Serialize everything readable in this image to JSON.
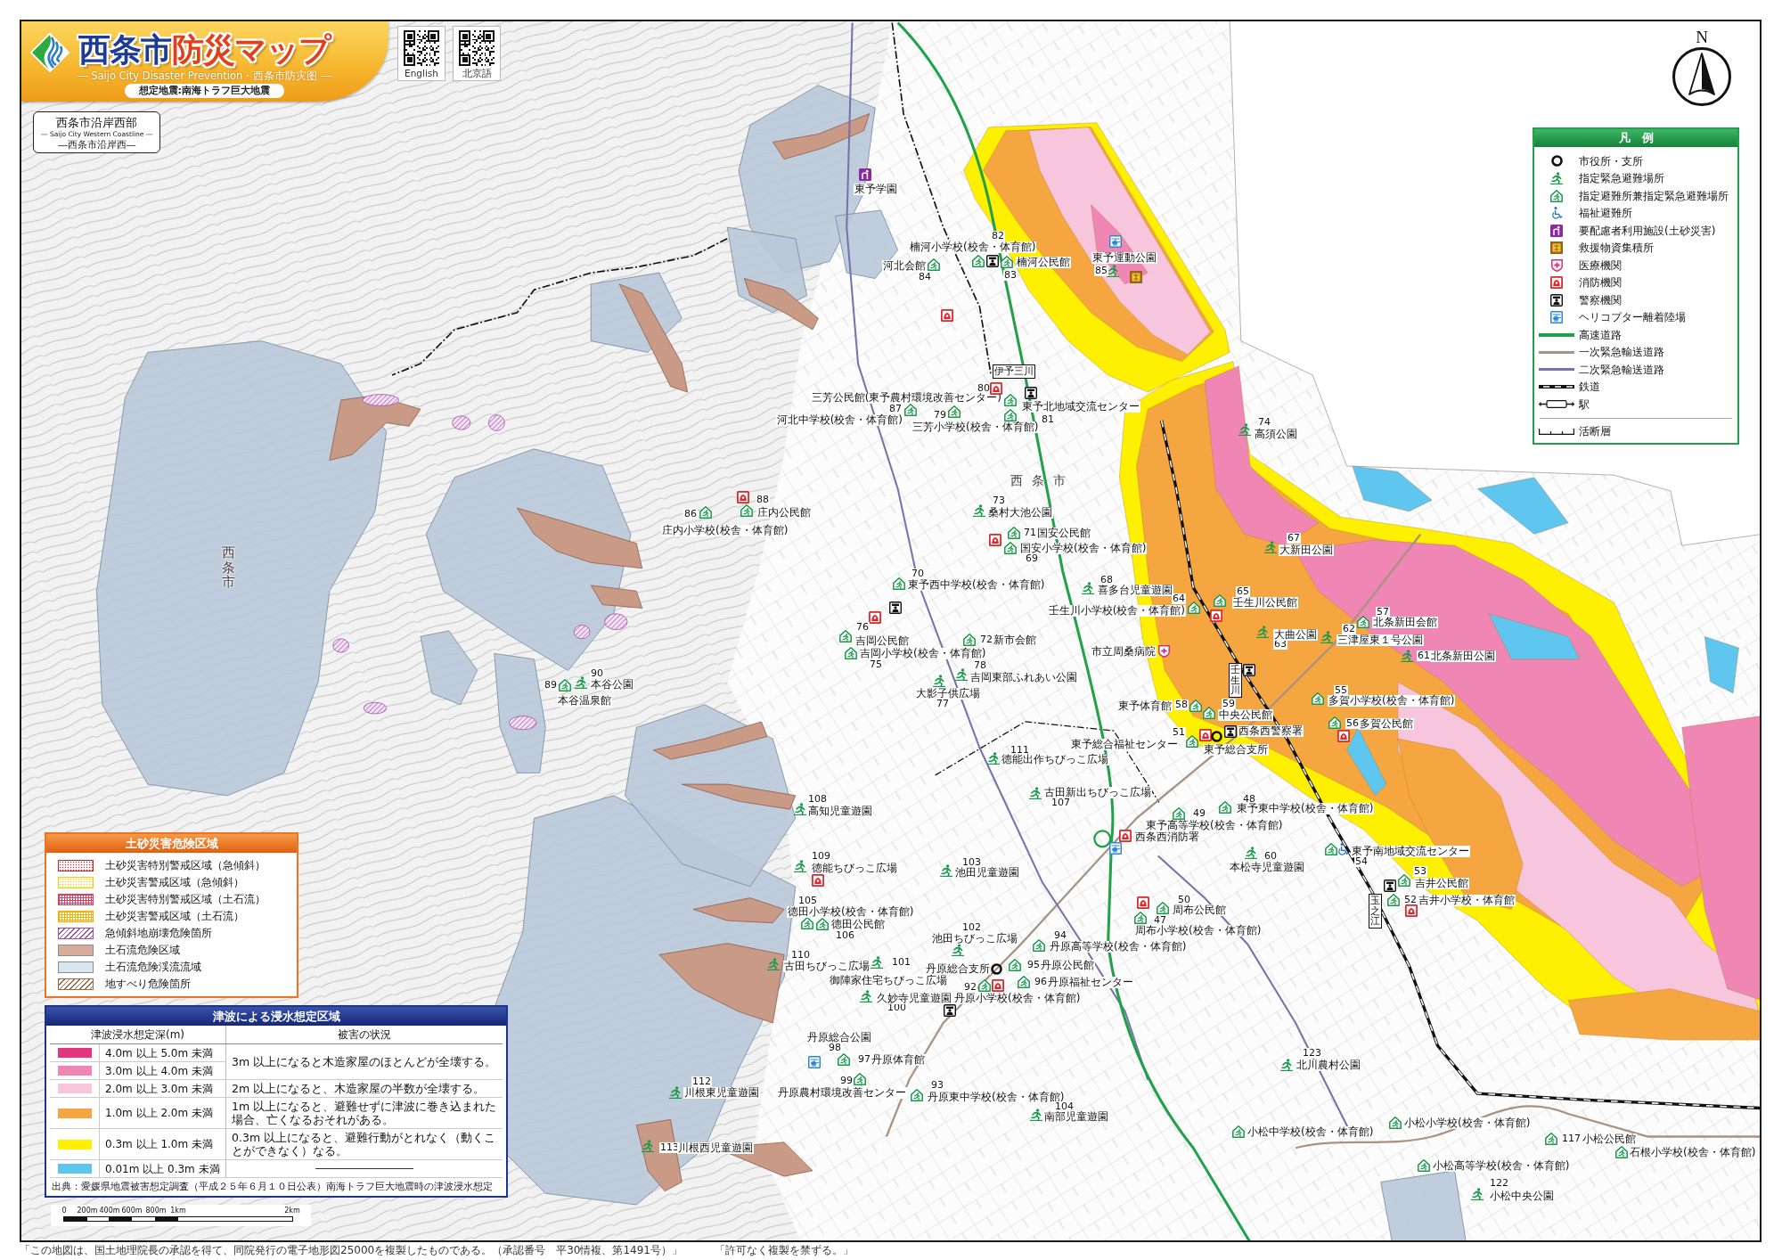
{
  "title": {
    "city": "西条市",
    "name": "防災マップ",
    "subtitle": "― Saijo City Disaster Prevention・西条市防灾图 ―",
    "scenario": "想定地震:南海トラフ巨大地震"
  },
  "qr_codes": [
    {
      "label": "English"
    },
    {
      "label": "北京語"
    }
  ],
  "area": {
    "name": "西条市沿岸西部",
    "english": "― Saijo City Western Coastline ―",
    "chinese": "―西条市沿岸西―"
  },
  "north_arrow": {
    "label": "N"
  },
  "legend": {
    "title": "凡　例",
    "items": [
      {
        "kind": "city-hall",
        "label": "市役所・支所"
      },
      {
        "kind": "evacuation-site",
        "label": "指定緊急避難場所"
      },
      {
        "kind": "shelter",
        "label": "指定避難所兼指定緊急避難場所"
      },
      {
        "kind": "welfare",
        "label": "福祉避難所"
      },
      {
        "kind": "care-facility",
        "label": "要配慮者利用施設(土砂災害)"
      },
      {
        "kind": "supply-depot",
        "label": "救援物資集積所"
      },
      {
        "kind": "medical",
        "label": "医療機関"
      },
      {
        "kind": "fire",
        "label": "消防機関"
      },
      {
        "kind": "police",
        "label": "警察機関"
      },
      {
        "kind": "heliport",
        "label": "ヘリコプター離着陸場"
      },
      {
        "kind": "expressway",
        "label": "高速道路"
      },
      {
        "kind": "primary-road",
        "label": "一次緊急輸送道路"
      },
      {
        "kind": "secondary-road",
        "label": "二次緊急輸送道路"
      },
      {
        "kind": "railway",
        "label": "鉄道"
      },
      {
        "kind": "station",
        "label": "駅"
      }
    ],
    "items_after_rule": [
      {
        "kind": "fault",
        "label": "活断層"
      }
    ]
  },
  "landslide_legend": {
    "title": "土砂災害危険区域",
    "items": [
      {
        "kind": "dots",
        "color": "#d9252a",
        "label": "土砂災害特別警戒区域（急傾斜）"
      },
      {
        "kind": "dots",
        "color": "#f2d200",
        "label": "土砂災害警戒区域（急傾斜）"
      },
      {
        "kind": "grid",
        "color": "#e0405e",
        "label": "土砂災害特別警戒区域（土石流）"
      },
      {
        "kind": "grid",
        "color": "#f0b400",
        "label": "土砂災害警戒区域（土石流）"
      },
      {
        "kind": "hatch",
        "color": "#a24ca8",
        "label": "急傾斜地崩壊危険箇所"
      },
      {
        "kind": "solid",
        "color": "#d8ac9c",
        "label": "土石流危険区域"
      },
      {
        "kind": "solid",
        "color": "#d8e6f0",
        "label": "土石流危険渓流流域"
      },
      {
        "kind": "hatch",
        "color": "#9c6a40",
        "label": "地すべり危険箇所"
      }
    ]
  },
  "tsunami_legend": {
    "title": "津波による浸水想定区域",
    "depth_header": "津波浸水想定深(m)",
    "damage_header": "被害の状況",
    "bands": [
      {
        "note": "3m 以上になると木造家屋のほとんどが全壊する。",
        "depths": [
          {
            "color": "#e5347f",
            "label": "4.0m 以上 5.0m 未満"
          },
          {
            "color": "#ef86b4",
            "label": "3.0m 以上 4.0m 未満"
          }
        ]
      },
      {
        "note": "2m 以上になると、木造家屋の半数が全壊する。",
        "depths": [
          {
            "color": "#f7c6dc",
            "label": "2.0m 以上 3.0m 未満"
          }
        ]
      },
      {
        "note": "1m 以上になると、避難せずに津波に巻き込まれた場合、亡くなるおそれがある。",
        "depths": [
          {
            "color": "#f5a640",
            "label": "1.0m 以上 2.0m 未満"
          }
        ]
      },
      {
        "note": "0.3m 以上になると、避難行動がとれなく（動くことができなく）なる。",
        "depths": [
          {
            "color": "#fff000",
            "label": "0.3m 以上 1.0m 未満"
          }
        ]
      },
      {
        "depths": [
          {
            "color": "#5ec6ef",
            "label": "0.01m 以上 0.3m 未満"
          }
        ]
      }
    ],
    "source": "出典：愛媛県地震被害想定調査（平成２５年６月１０日公表）南海トラフ巨大地震時の津波浸水想定"
  },
  "scale_bar": {
    "labels": [
      "0",
      "200m",
      "400m",
      "600m",
      "800m",
      "1km",
      "2km"
    ]
  },
  "map": {
    "place_names": [
      {
        "kind": "vertical",
        "text": "西条市"
      },
      {
        "kind": "horizontal",
        "text": "西条市"
      }
    ],
    "stations": [
      {
        "name": "伊予三川"
      },
      {
        "name": "壬生川"
      },
      {
        "name": "玉之江"
      }
    ],
    "facilities": [
      {
        "kind": "care-facility",
        "name": "東予学園"
      },
      {
        "kind": "shelter",
        "number": "82",
        "name": "楠河小学校(校舎・体育館)"
      },
      {
        "kind": "heliport"
      },
      {
        "kind": "shelter",
        "number": "84",
        "name": "河北会館"
      },
      {
        "kind": "police"
      },
      {
        "kind": "shelter",
        "number": "83",
        "name": "楠河公民館"
      },
      {
        "kind": "evacuation-site",
        "number": "85",
        "name": "東予運動公園"
      },
      {
        "kind": "supply-depot"
      },
      {
        "kind": "fire"
      },
      {
        "kind": "shelter",
        "number": "80",
        "name": "三芳公民館(東予農村環境改善センター)"
      },
      {
        "kind": "fire"
      },
      {
        "kind": "police"
      },
      {
        "kind": "shelter",
        "number": "87",
        "name": "河北中学校(校舎・体育館)"
      },
      {
        "kind": "shelter",
        "number": "79",
        "name": "三芳小学校(校舎・体育館)"
      },
      {
        "kind": "shelter",
        "number": "81",
        "name": "東予北地域交流センター"
      },
      {
        "kind": "evacuation-site",
        "number": "74",
        "name": "高須公園"
      },
      {
        "kind": "fire"
      },
      {
        "kind": "shelter",
        "number": "88",
        "name": "庄内公民館"
      },
      {
        "kind": "evacuation-site",
        "number": "73",
        "name": "桑村大池公園"
      },
      {
        "kind": "shelter",
        "number": "86",
        "name": "庄内小学校(校舎・体育館)"
      },
      {
        "kind": "fire"
      },
      {
        "kind": "shelter",
        "number": "71",
        "name": "国安公民館"
      },
      {
        "kind": "shelter",
        "number": "69",
        "name": "国安小学校(校舎・体育館)"
      },
      {
        "kind": "evacuation-site",
        "number": "67",
        "name": "大新田公園"
      },
      {
        "kind": "shelter",
        "number": "70",
        "name": "東予西中学校(校舎・体育館)"
      },
      {
        "kind": "evacuation-site",
        "number": "68",
        "name": "喜多台児童遊園"
      },
      {
        "kind": "fire"
      },
      {
        "kind": "police"
      },
      {
        "kind": "shelter",
        "number": "64",
        "name": "壬生川小学校(校舎・体育館)"
      },
      {
        "kind": "shelter",
        "number": "65",
        "name": "壬生川公民館"
      },
      {
        "kind": "fire"
      },
      {
        "kind": "shelter",
        "number": "57",
        "name": "北条新田会館"
      },
      {
        "kind": "shelter",
        "number": "76",
        "name": "吉岡公民館"
      },
      {
        "kind": "shelter",
        "number": "72",
        "name": "新市会館"
      },
      {
        "kind": "evacuation-site",
        "number": "63",
        "name": "大曲公園"
      },
      {
        "kind": "evacuation-site",
        "number": "62",
        "name": "三津屋東１号公園"
      },
      {
        "kind": "shelter",
        "number": "75",
        "name": "吉岡小学校(校舎・体育館)"
      },
      {
        "kind": "medical",
        "name": "市立周桑病院"
      },
      {
        "kind": "evacuation-site",
        "number": "78",
        "name": "吉岡東部ふれあい公園"
      },
      {
        "kind": "evacuation-site",
        "number": "61",
        "name": "北条新田公園"
      },
      {
        "kind": "evacuation-site",
        "number": "90",
        "name": "本谷公園"
      },
      {
        "kind": "police"
      },
      {
        "kind": "shelter",
        "number": "89",
        "name": "本谷温泉館"
      },
      {
        "kind": "evacuation-site",
        "number": "77",
        "name": "大影子供広場"
      },
      {
        "kind": "shelter",
        "number": "58",
        "name": "東予体育館"
      },
      {
        "kind": "shelter",
        "number": "59",
        "name": "中央公民館"
      },
      {
        "kind": "shelter",
        "number": "55",
        "name": "多賀小学校(校舎・体育館)"
      },
      {
        "kind": "shelter",
        "number": "51",
        "name": "東予総合福祉センター"
      },
      {
        "kind": "fire"
      },
      {
        "kind": "city-hall",
        "name": "東予総合支所"
      },
      {
        "kind": "police",
        "name": "西条西警察署"
      },
      {
        "kind": "shelter",
        "number": "56",
        "name": "多賀公民館"
      },
      {
        "kind": "fire"
      },
      {
        "kind": "evacuation-site",
        "number": "111",
        "name": "徳能出作ちびっこ広場"
      },
      {
        "kind": "evacuation-site",
        "number": "108",
        "name": "高知児童遊園"
      },
      {
        "kind": "evacuation-site",
        "number": "107",
        "name": "古田新出ちびっこ広場"
      },
      {
        "kind": "shelter",
        "number": "48",
        "name": "東予東中学校(校舎・体育館)"
      },
      {
        "kind": "shelter",
        "number": "49",
        "name": "東予高等学校(校舎・体育館)"
      },
      {
        "kind": "fire",
        "name": "西条西消防署"
      },
      {
        "kind": "evacuation-site",
        "number": "109",
        "name": "徳能ちびっこ広場"
      },
      {
        "kind": "evacuation-site",
        "number": "103",
        "name": "池田児童遊園"
      },
      {
        "kind": "heliport"
      },
      {
        "kind": "evacuation-site",
        "number": "60",
        "name": "本松寺児童遊園"
      },
      {
        "kind": "shelter",
        "number": "54",
        "name": "東予南地域交流センター"
      },
      {
        "kind": "welfare"
      },
      {
        "kind": "fire"
      },
      {
        "kind": "police"
      },
      {
        "kind": "shelter",
        "number": "53",
        "name": "吉井公民館"
      },
      {
        "kind": "shelter",
        "number": "105",
        "name": "徳田小学校(校舎・体育館)"
      },
      {
        "kind": "fire"
      },
      {
        "kind": "shelter",
        "number": "50",
        "name": "周布公民館"
      },
      {
        "kind": "shelter",
        "number": "52",
        "name": "吉井小学校・体育館"
      },
      {
        "kind": "fire"
      },
      {
        "kind": "shelter",
        "number": "106",
        "name": "徳田公民館"
      },
      {
        "kind": "evacuation-site",
        "number": "102",
        "name": "池田ちびっこ広場"
      },
      {
        "kind": "shelter",
        "number": "94",
        "name": "丹原高等学校(校舎・体育館)"
      },
      {
        "kind": "shelter",
        "number": "47",
        "name": "周布小学校(校舎・体育館)"
      },
      {
        "kind": "evacuation-site",
        "number": "110",
        "name": "古田ちびっこ広場"
      },
      {
        "kind": "evacuation-site",
        "number": "101",
        "name": "御陣家住宅ちびっこ広場"
      },
      {
        "kind": "city-hall",
        "name": "丹原総合支所"
      },
      {
        "kind": "shelter",
        "number": "95",
        "name": "丹原公民館"
      },
      {
        "kind": "shelter",
        "number": "92",
        "name": "丹原小学校(校舎・体育館)"
      },
      {
        "kind": "fire"
      },
      {
        "kind": "shelter",
        "number": "96",
        "name": "丹原福祉センター"
      },
      {
        "kind": "evacuation-site",
        "number": "100",
        "name": "久妙寺児童遊園"
      },
      {
        "kind": "police"
      },
      {
        "kind": "heliport",
        "number": "98",
        "name": "丹原総合公園"
      },
      {
        "kind": "shelter",
        "number": "97",
        "name": "丹原体育館"
      },
      {
        "kind": "evacuation-site",
        "number": "123",
        "name": "北川農村公園"
      },
      {
        "kind": "evacuation-site",
        "number": "112",
        "name": "川根東児童遊園"
      },
      {
        "kind": "shelter",
        "number": "99",
        "name": "丹原農村環境改善センター"
      },
      {
        "kind": "shelter",
        "number": "93",
        "name": "丹原東中学校(校舎・体育館)"
      },
      {
        "kind": "evacuation-site",
        "number": "104",
        "name": "南部児童遊園"
      },
      {
        "kind": "shelter",
        "name": "小松中学校(校舎・体育館)"
      },
      {
        "kind": "shelter",
        "name": "小松小学校(校舎・体育館)"
      },
      {
        "kind": "evacuation-site",
        "number": "113",
        "name": "川根西児童遊園"
      },
      {
        "kind": "shelter",
        "number": "117",
        "name": "小松公民館"
      },
      {
        "kind": "shelter",
        "name": "石根小学校(校舎・体育館)"
      },
      {
        "kind": "shelter",
        "name": "小松高等学校(校舎・体育館)"
      },
      {
        "kind": "evacuation-site",
        "number": "122",
        "name": "小松中央公園"
      }
    ]
  },
  "footnote": [
    "「この地図は、国土地理院長の承認を得て、同院発行の電子地形図25000を複製したものである。（承認番号　平30情複、第1491号）」",
    "「許可なく複製を禁ずる。」"
  ]
}
